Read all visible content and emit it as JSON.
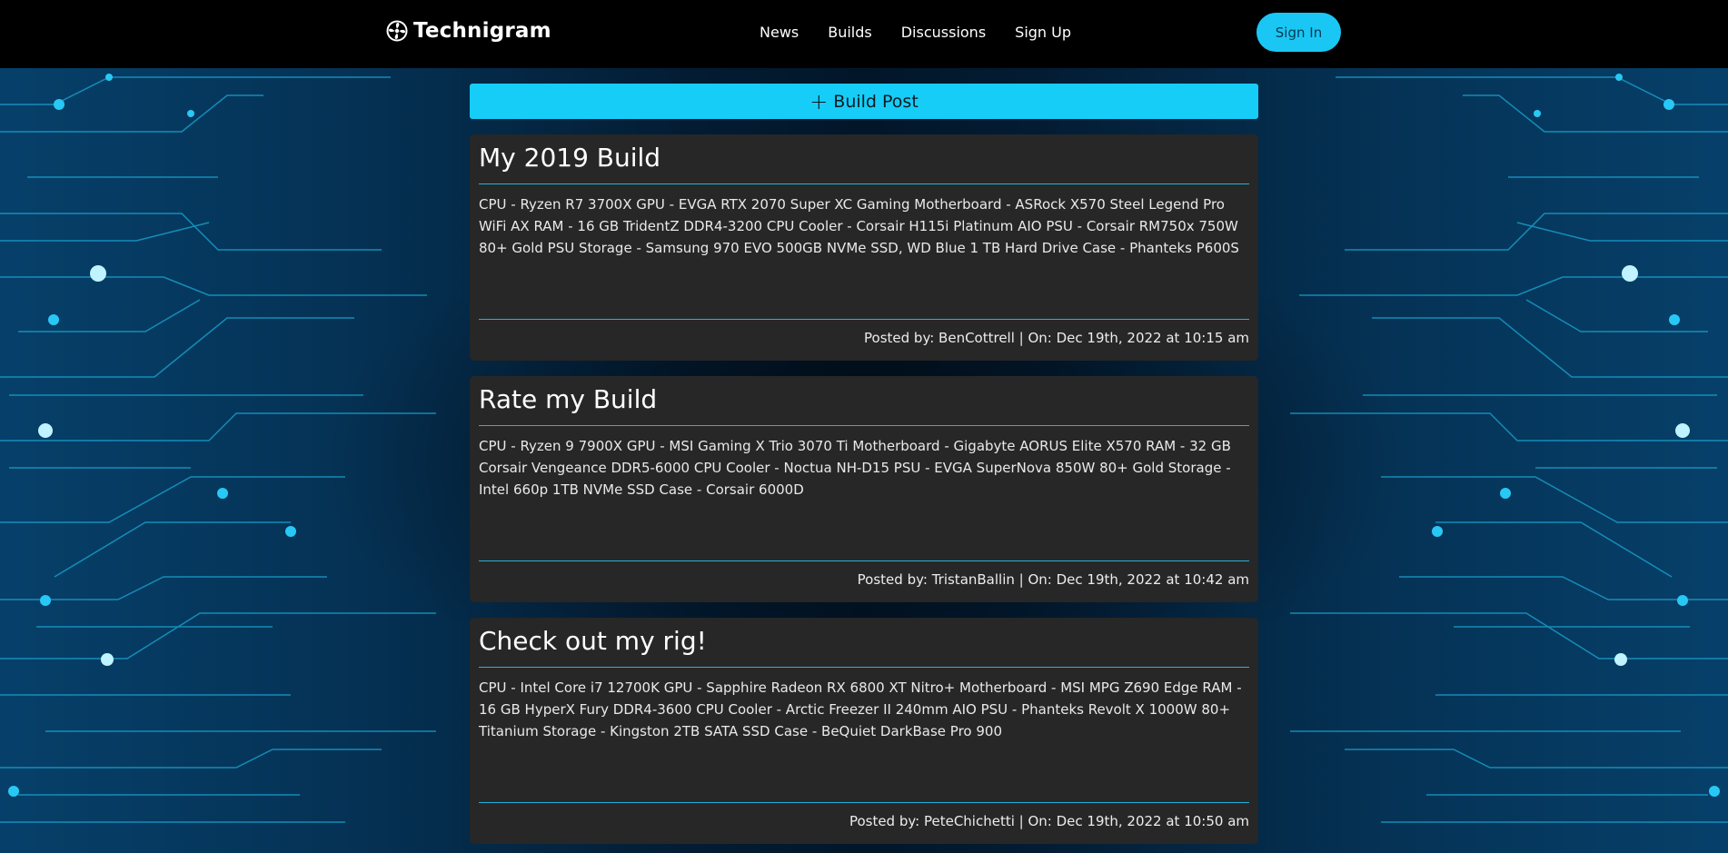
{
  "navbar": {
    "brand": "Technigram",
    "brand_icon": "fan-icon",
    "links": [
      "News",
      "Builds",
      "Discussions",
      "Sign Up"
    ],
    "signin_label": "Sign In"
  },
  "actions": {
    "build_post_label": "Build Post"
  },
  "posts": [
    {
      "title": "My 2019 Build",
      "body": "CPU - Ryzen R7 3700X GPU - EVGA RTX 2070 Super XC Gaming Motherboard - ASRock X570 Steel Legend Pro WiFi AX RAM - 16 GB TridentZ DDR4-3200 CPU Cooler - Corsair H115i Platinum AIO PSU - Corsair RM750x 750W 80+ Gold PSU Storage - Samsung 970 EVO 500GB NVMe SSD, WD Blue 1 TB Hard Drive Case - Phanteks P600S",
      "meta": "Posted by: BenCottrell | On: Dec 19th, 2022 at 10:15 am"
    },
    {
      "title": "Rate my Build",
      "body": "CPU - Ryzen 9 7900X GPU - MSI Gaming X Trio 3070 Ti Motherboard - Gigabyte AORUS Elite X570 RAM - 32 GB Corsair Vengeance DDR5-6000 CPU Cooler - Noctua NH-D15 PSU - EVGA SuperNova 850W 80+ Gold Storage - Intel 660p 1TB NVMe SSD Case - Corsair 6000D",
      "meta": "Posted by: TristanBallin | On: Dec 19th, 2022 at 10:42 am"
    },
    {
      "title": "Check out my rig!",
      "body": "CPU - Intel Core i7 12700K GPU - Sapphire Radeon RX 6800 XT Nitro+ Motherboard - MSI MPG Z690 Edge RAM - 16 GB HyperX Fury DDR4-3600 CPU Cooler - Arctic Freezer II 240mm AIO PSU - Phanteks Revolt X 1000W 80+ Titanium Storage - Kingston 2TB SATA SSD Case - BeQuiet DarkBase Pro 900",
      "meta": "Posted by: PeteChichetti | On: Dec 19th, 2022 at 10:50 am"
    }
  ],
  "colors": {
    "accent": "#16cdf8",
    "navbar_bg": "#000000",
    "card_bg": "#272727",
    "rule": "#23b3d8"
  }
}
